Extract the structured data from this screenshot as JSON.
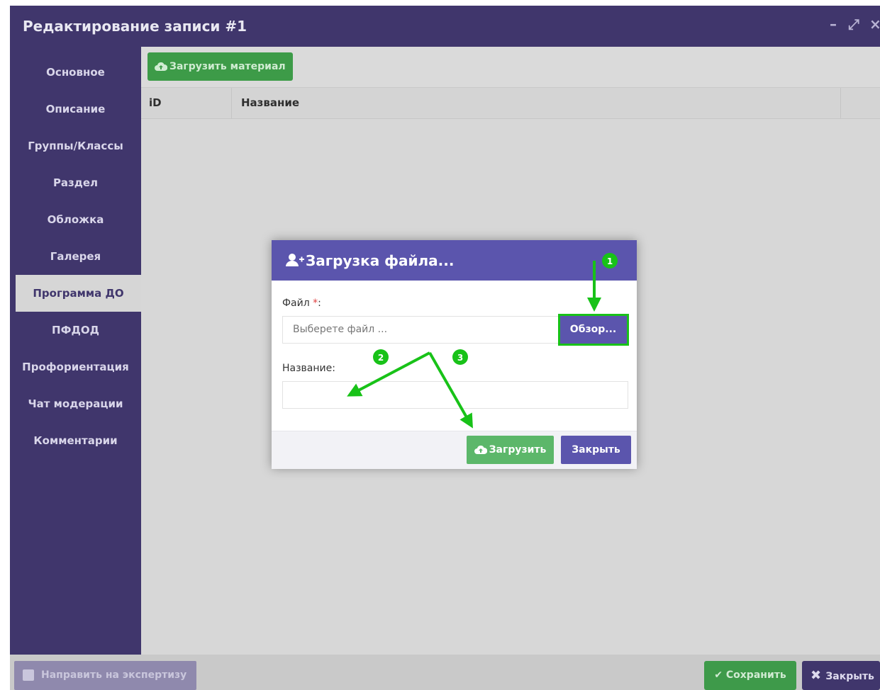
{
  "window": {
    "title": "Редактирование записи #1",
    "minimize_glyph": "–",
    "maximize_glyph": "⤢",
    "close_glyph": "×"
  },
  "sidebar": {
    "items": [
      {
        "label": "Основное"
      },
      {
        "label": "Описание"
      },
      {
        "label": "Группы/Классы"
      },
      {
        "label": "Раздел"
      },
      {
        "label": "Обложка"
      },
      {
        "label": "Галерея"
      },
      {
        "label": "Программа ДО",
        "active": true
      },
      {
        "label": "ПФДОД"
      },
      {
        "label": "Профориентация"
      },
      {
        "label": "Чат модерации"
      },
      {
        "label": "Комментарии"
      }
    ]
  },
  "toolbar": {
    "upload_material_label": "Загрузить материал"
  },
  "table": {
    "columns": [
      "iD",
      "Название"
    ]
  },
  "footer": {
    "expertise_label": "Направить на экспертизу",
    "save_label": "Сохранить",
    "close_label": "Закрыть"
  },
  "modal": {
    "title": "Загрузка файла...",
    "file_label": "Файл",
    "required_mark": "*",
    "label_colon": ":",
    "file_placeholder": "Выберете файл ...",
    "browse_label": "Обзор...",
    "name_label": "Название:",
    "name_value": "",
    "upload_label": "Загрузить",
    "close_label": "Закрыть"
  },
  "annotations": {
    "badge_1": "1",
    "badge_2": "2",
    "badge_3": "3",
    "accent_color": "#18c218"
  },
  "colors": {
    "sidebar_bg": "#40366c",
    "modal_header": "#5b55ad",
    "success": "#3e9a4a"
  }
}
